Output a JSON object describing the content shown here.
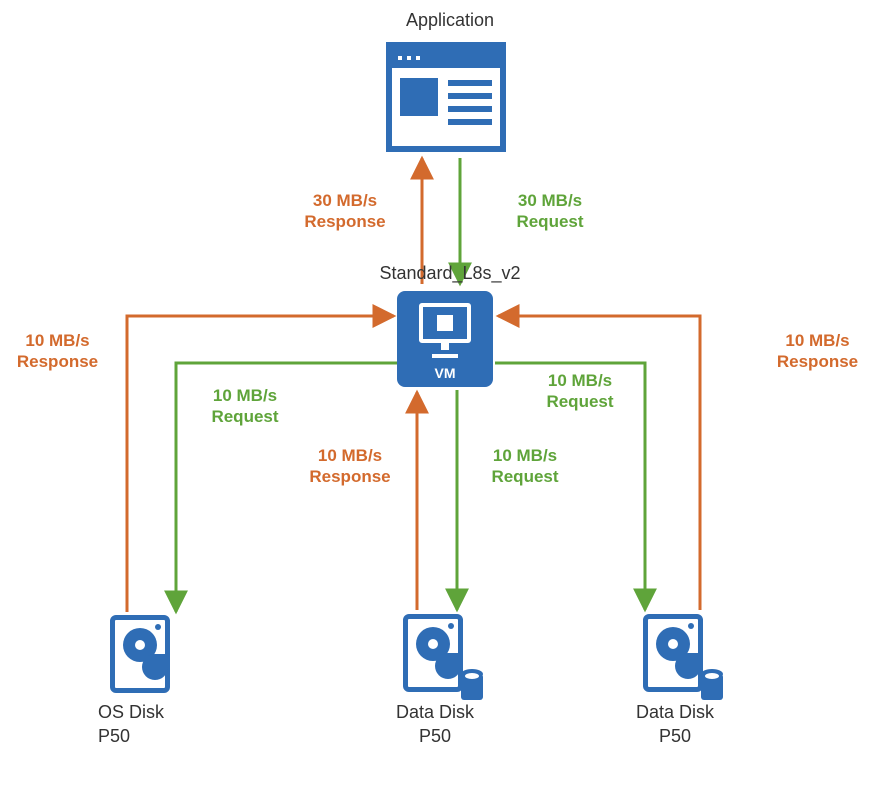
{
  "application": {
    "label": "Application"
  },
  "vm": {
    "label": "Standard_L8s_v2",
    "badge": "VM"
  },
  "disks": {
    "os": {
      "name": "OS Disk",
      "tier": "P50"
    },
    "d1": {
      "name": "Data Disk",
      "tier": "P50"
    },
    "d2": {
      "name": "Data Disk",
      "tier": "P50"
    }
  },
  "flows": {
    "app_to_vm_request": "30 MB/s\nRequest",
    "vm_to_app_response": "30 MB/s\nResponse",
    "vm_to_os_request": "10 MB/s\nRequest",
    "os_to_vm_response": "10 MB/s\nResponse",
    "vm_to_d1_request": "10 MB/s\nRequest",
    "d1_to_vm_response": "10 MB/s\nResponse",
    "vm_to_d2_request": "10 MB/s\nRequest",
    "d2_to_vm_response": "10 MB/s\nResponse"
  },
  "colors": {
    "blue": "#2f6db5",
    "green": "#5fa43a",
    "orange": "#d36a2d"
  }
}
